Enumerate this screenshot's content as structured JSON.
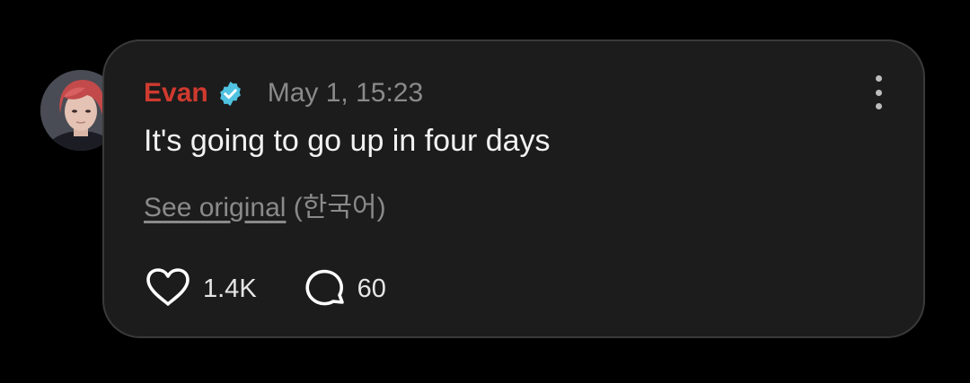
{
  "post": {
    "author": "Evan",
    "verified": true,
    "timestamp": "May 1, 15:23",
    "message": "It's going to go up in four days",
    "translation": {
      "link_label": "See original",
      "language": "(한국어)"
    },
    "likes": "1.4K",
    "comments": "60"
  },
  "icons": {
    "avatar": "profile-photo",
    "verified": "verified-badge-icon",
    "more": "more-vertical-icon",
    "like": "heart-outline-icon",
    "comment": "speech-bubble-icon"
  },
  "colors": {
    "author": "#d03a2f",
    "verified": "#4fc3e0",
    "card_bg": "#1c1c1c",
    "page_bg": "#000000"
  }
}
